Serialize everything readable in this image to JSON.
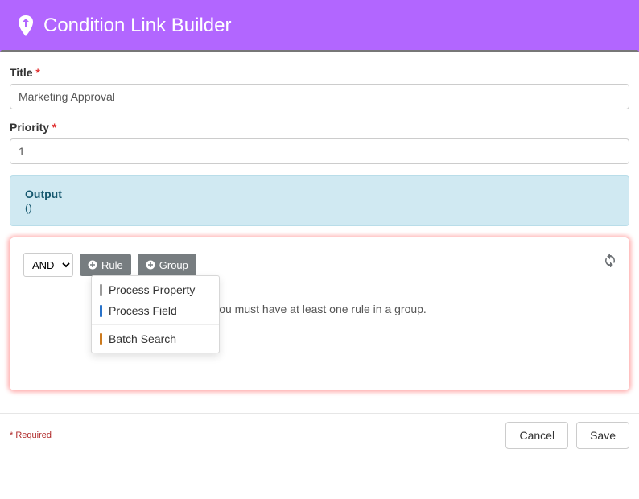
{
  "header": {
    "title": "Condition Link Builder"
  },
  "form": {
    "title_label": "Title",
    "title_value": "Marketing Approval",
    "priority_label": "Priority",
    "priority_value": "1"
  },
  "output": {
    "heading": "Output",
    "value": "()"
  },
  "rules": {
    "operator": "AND",
    "add_rule_label": "Rule",
    "add_group_label": "Group",
    "empty_message": "You must have at least one rule in a group.",
    "dropdown": {
      "items": [
        {
          "label": "Process Property",
          "color": "grey"
        },
        {
          "label": "Process Field",
          "color": "blue"
        },
        {
          "label": "Batch Search",
          "color": "orange"
        }
      ]
    }
  },
  "footer": {
    "required_note": "* Required",
    "cancel_label": "Cancel",
    "save_label": "Save"
  }
}
